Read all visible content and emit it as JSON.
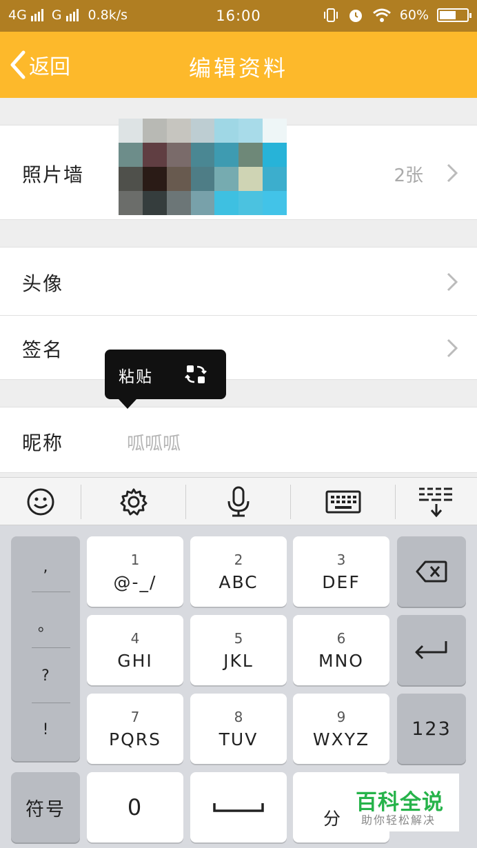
{
  "status_bar": {
    "network1": "4G",
    "network2": "G",
    "speed": "0.8k/s",
    "time": "16:00",
    "battery": "60%",
    "battery_level": 0.6
  },
  "header": {
    "back_label": "返回",
    "title": "编辑资料"
  },
  "rows": {
    "photo_wall": {
      "label": "照片墙",
      "count": "2张"
    },
    "avatar": {
      "label": "头像"
    },
    "signature": {
      "label": "签名"
    },
    "nickname": {
      "label": "昵称",
      "value": "呱呱呱"
    }
  },
  "popup": {
    "paste_label": "粘贴"
  },
  "keyboard": {
    "toolbar": [
      "emoji-icon",
      "settings-icon",
      "microphone-icon",
      "keyboard-icon",
      "collapse-keyboard-icon"
    ],
    "punctuation": [
      ",",
      "。",
      "?",
      "!"
    ],
    "keys": [
      {
        "num": "1",
        "letters": "@-_/"
      },
      {
        "num": "2",
        "letters": "ABC"
      },
      {
        "num": "3",
        "letters": "DEF"
      },
      {
        "num": "4",
        "letters": "GHI"
      },
      {
        "num": "5",
        "letters": "JKL"
      },
      {
        "num": "6",
        "letters": "MNO"
      },
      {
        "num": "7",
        "letters": "PQRS"
      },
      {
        "num": "8",
        "letters": "TUV"
      },
      {
        "num": "9",
        "letters": "WXYZ"
      }
    ],
    "numbers_key": "123",
    "symbols_key": "符号",
    "zero_key": "0",
    "partial_key": "分"
  },
  "watermark": {
    "title": "百科全说",
    "subtitle": "助你轻松解决"
  },
  "colors": {
    "header": "#fdb92b",
    "status": "#b07e22",
    "watermark": "#26b34a"
  }
}
